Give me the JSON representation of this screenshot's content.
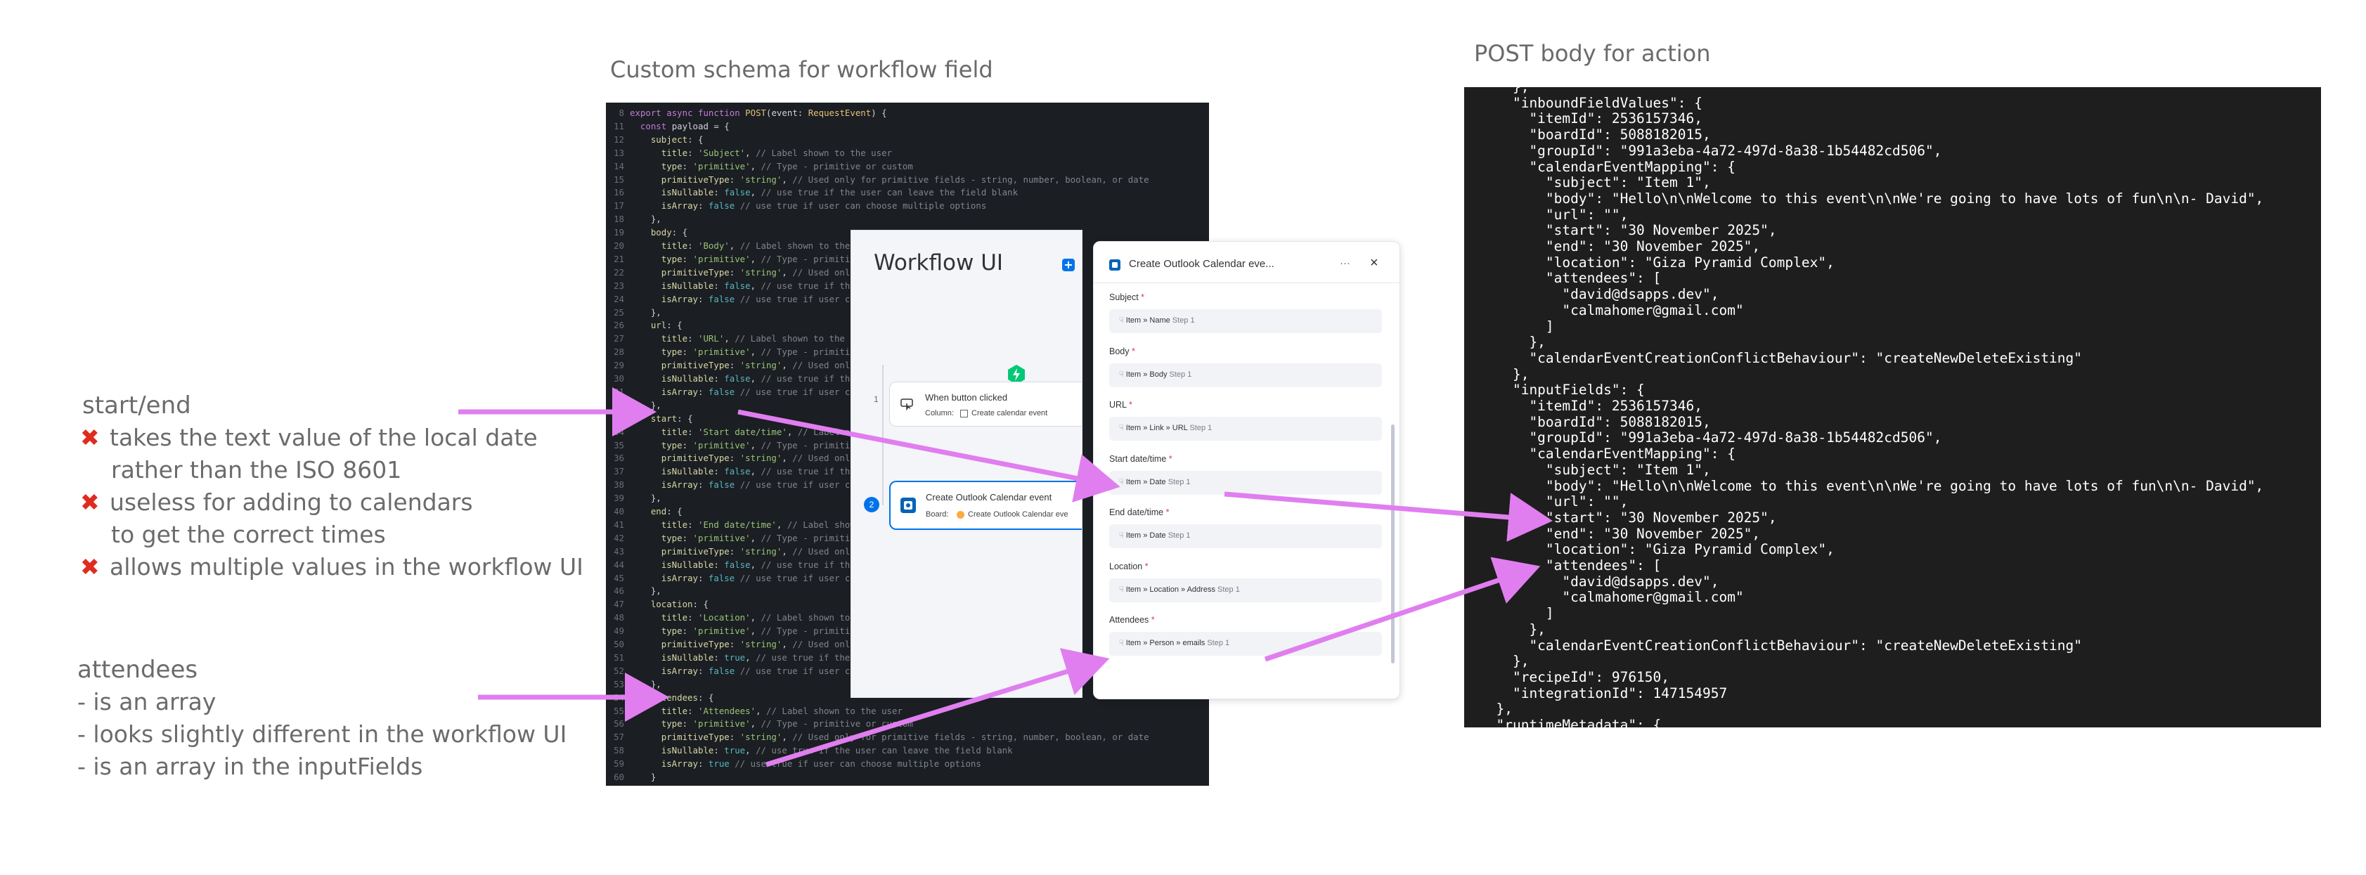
{
  "headings": {
    "schema": "Custom schema for workflow field",
    "post": "POST body for action"
  },
  "notes": {
    "start_end": {
      "title": "start/end",
      "lines": [
        {
          "mark": "✖",
          "text": "takes the text value of the local date"
        },
        {
          "mark": "",
          "text": "rather than the ISO 8601"
        },
        {
          "mark": "✖",
          "text": "useless for adding to calendars"
        },
        {
          "mark": "",
          "text": "to get the correct times"
        },
        {
          "mark": "✖",
          "text": "allows multiple values in the workflow UI"
        }
      ]
    },
    "attendees": {
      "title": "attendees",
      "lines": [
        "- is an array",
        "- looks slightly different in the workflow UI",
        "- is an array in the inputFields"
      ]
    }
  },
  "code": {
    "lines": [
      {
        "n": "8",
        "t": "export async function POST(event: RequestEvent) {"
      },
      {
        "n": "11",
        "t": "  const payload = {"
      },
      {
        "n": "12",
        "t": "    subject: {"
      },
      {
        "n": "13",
        "t": "      title: 'Subject', // Label shown to the user"
      },
      {
        "n": "14",
        "t": "      type: 'primitive', // Type - primitive or custom"
      },
      {
        "n": "15",
        "t": "      primitiveType: 'string', // Used only for primitive fields - string, number, boolean, or date"
      },
      {
        "n": "16",
        "t": "      isNullable: false, // use true if the user can leave the field blank"
      },
      {
        "n": "17",
        "t": "      isArray: false // use true if user can choose multiple options"
      },
      {
        "n": "18",
        "t": "    },"
      },
      {
        "n": "19",
        "t": "    body: {"
      },
      {
        "n": "20",
        "t": "      title: 'Body', // Label shown to the user"
      },
      {
        "n": "21",
        "t": "      type: 'primitive', // Type - primitive or custom"
      },
      {
        "n": "22",
        "t": "      primitiveType: 'string', // Used only for primitive fields"
      },
      {
        "n": "23",
        "t": "      isNullable: false, // use true if the user can leave the field blank"
      },
      {
        "n": "24",
        "t": "      isArray: false // use true if user can choose multiple options"
      },
      {
        "n": "25",
        "t": "    },"
      },
      {
        "n": "26",
        "t": "    url: {"
      },
      {
        "n": "27",
        "t": "      title: 'URL', // Label shown to the user"
      },
      {
        "n": "28",
        "t": "      type: 'primitive', // Type - primitive or custom"
      },
      {
        "n": "29",
        "t": "      primitiveType: 'string', // Used only for primitive fields"
      },
      {
        "n": "30",
        "t": "      isNullable: false, // use true if the user can leave the field blank"
      },
      {
        "n": "31",
        "t": "      isArray: false // use true if user can choose multiple options"
      },
      {
        "n": "32",
        "t": "    },"
      },
      {
        "n": "33",
        "t": "    start: {"
      },
      {
        "n": "34",
        "t": "      title: 'Start date/time', // Label shown to the user"
      },
      {
        "n": "35",
        "t": "      type: 'primitive', // Type - primitive or custom"
      },
      {
        "n": "36",
        "t": "      primitiveType: 'string', // Used only for primitive fields"
      },
      {
        "n": "37",
        "t": "      isNullable: false, // use true if the user can leave the field blank"
      },
      {
        "n": "38",
        "t": "      isArray: false // use true if user can choose multiple options"
      },
      {
        "n": "39",
        "t": "    },"
      },
      {
        "n": "40",
        "t": "    end: {"
      },
      {
        "n": "41",
        "t": "      title: 'End date/time', // Label shown to the user"
      },
      {
        "n": "42",
        "t": "      type: 'primitive', // Type - primitive or custom"
      },
      {
        "n": "43",
        "t": "      primitiveType: 'string', // Used only for primitive fields"
      },
      {
        "n": "44",
        "t": "      isNullable: false, // use true if the user can leave the field blank"
      },
      {
        "n": "45",
        "t": "      isArray: false // use true if user can choose multiple options"
      },
      {
        "n": "46",
        "t": "    },"
      },
      {
        "n": "47",
        "t": "    location: {"
      },
      {
        "n": "48",
        "t": "      title: 'Location', // Label shown to the user"
      },
      {
        "n": "49",
        "t": "      type: 'primitive', // Type - primitive or custom"
      },
      {
        "n": "50",
        "t": "      primitiveType: 'string', // Used only for primitive fields"
      },
      {
        "n": "51",
        "t": "      isNullable: true, // use true if the user can leave the field blank"
      },
      {
        "n": "52",
        "t": "      isArray: false // use true if user can choose multiple options"
      },
      {
        "n": "53",
        "t": "    },"
      },
      {
        "n": "54",
        "t": "    attendees: {"
      },
      {
        "n": "55",
        "t": "      title: 'Attendees', // Label shown to the user"
      },
      {
        "n": "56",
        "t": "      type: 'primitive', // Type - primitive or custom"
      },
      {
        "n": "57",
        "t": "      primitiveType: 'string', // Used only for primitive fields - string, number, boolean, or date"
      },
      {
        "n": "58",
        "t": "      isNullable: true, // use true if the user can leave the field blank"
      },
      {
        "n": "59",
        "t": "      isArray: true // use true if user can choose multiple options"
      },
      {
        "n": "60",
        "t": "    }"
      }
    ]
  },
  "workflow": {
    "title": "Workflow UI",
    "trigger": {
      "number": "1",
      "title": "When button clicked",
      "column_label": "Column:",
      "column_value": "Create calendar event"
    },
    "action": {
      "number": "2",
      "title": "Create Outlook Calendar event",
      "board_label": "Board:",
      "board_value": "Create Outlook Calendar eve"
    },
    "panel": {
      "title": "Create Outlook Calendar eve...",
      "more": "···",
      "close": "×",
      "fields": [
        {
          "label": "Subject",
          "value": "Item » Name",
          "step": "Step 1"
        },
        {
          "label": "Body",
          "value": "Item » Body",
          "step": "Step 1"
        },
        {
          "label": "URL",
          "value": "Item » Link » URL",
          "step": "Step 1"
        },
        {
          "label": "Start date/time",
          "value": "Item » Date",
          "step": "Step 1"
        },
        {
          "label": "End date/time",
          "value": "Item » Date",
          "step": "Step 1"
        },
        {
          "label": "Location",
          "value": "Item » Location » Address",
          "step": "Step 1"
        },
        {
          "label": "Attendees",
          "value": "Item » Person » emails",
          "step": "Step 1"
        }
      ]
    }
  },
  "post_body": {
    "lines": [
      "    },",
      "    \"inboundFieldValues\": {",
      "      \"itemId\": 2536157346,",
      "      \"boardId\": 5088182015,",
      "      \"groupId\": \"991a3eba-4a72-497d-8a38-1b54482cd506\",",
      "      \"calendarEventMapping\": {",
      "        \"subject\": \"Item 1\",",
      "        \"body\": \"Hello\\n\\nWelcome to this event\\n\\nWe're going to have lots of fun\\n\\n- David\",",
      "        \"url\": \"\",",
      "        \"start\": \"30 November 2025\",",
      "        \"end\": \"30 November 2025\",",
      "        \"location\": \"Giza Pyramid Complex\",",
      "        \"attendees\": [",
      "          \"david@dsapps.dev\",",
      "          \"calmahomer@gmail.com\"",
      "        ]",
      "      },",
      "      \"calendarEventCreationConflictBehaviour\": \"createNewDeleteExisting\"",
      "    },",
      "    \"inputFields\": {",
      "      \"itemId\": 2536157346,",
      "      \"boardId\": 5088182015,",
      "      \"groupId\": \"991a3eba-4a72-497d-8a38-1b54482cd506\",",
      "      \"calendarEventMapping\": {",
      "        \"subject\": \"Item 1\",",
      "        \"body\": \"Hello\\n\\nWelcome to this event\\n\\nWe're going to have lots of fun\\n\\n- David\",",
      "        \"url\": \"\",",
      "        \"start\": \"30 November 2025\",",
      "        \"end\": \"30 November 2025\",",
      "        \"location\": \"Giza Pyramid Complex\",",
      "        \"attendees\": [",
      "          \"david@dsapps.dev\",",
      "          \"calmahomer@gmail.com\"",
      "        ]",
      "      },",
      "      \"calendarEventCreationConflictBehaviour\": \"createNewDeleteExisting\"",
      "    },",
      "    \"recipeId\": 976150,",
      "    \"integrationId\": 147154957",
      "  },",
      "  \"runtimeMetadata\": {"
    ]
  },
  "colors": {
    "arrow": "#e07ef0",
    "x_mark": "#e02b1f",
    "code_bg": "#1b1e22",
    "post_bg": "#1e1e1e",
    "accent_blue": "#0073ea"
  }
}
